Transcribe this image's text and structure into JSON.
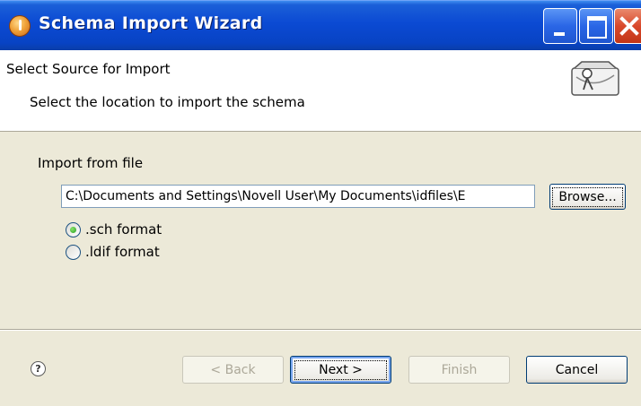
{
  "window": {
    "title": "Schema Import Wizard"
  },
  "header": {
    "title": "Select Source for Import",
    "description": "Select the location to import the schema",
    "icon": "wizard-banner-icon"
  },
  "form": {
    "import_label": "Import from file",
    "file_path": "C:\\Documents and Settings\\Novell User\\My Documents\\idfiles\\E",
    "browse_label": "Browse...",
    "options": [
      {
        "label": ".sch format",
        "checked": true
      },
      {
        "label": ".ldif format",
        "checked": false
      }
    ]
  },
  "footer": {
    "help": "?",
    "back_label": "< Back",
    "next_label": "Next >",
    "finish_label": "Finish",
    "cancel_label": "Cancel"
  },
  "colors": {
    "titlebar": "#0b4ad3",
    "dialog_bg": "#ece9d8",
    "close_button": "#d9482b"
  }
}
